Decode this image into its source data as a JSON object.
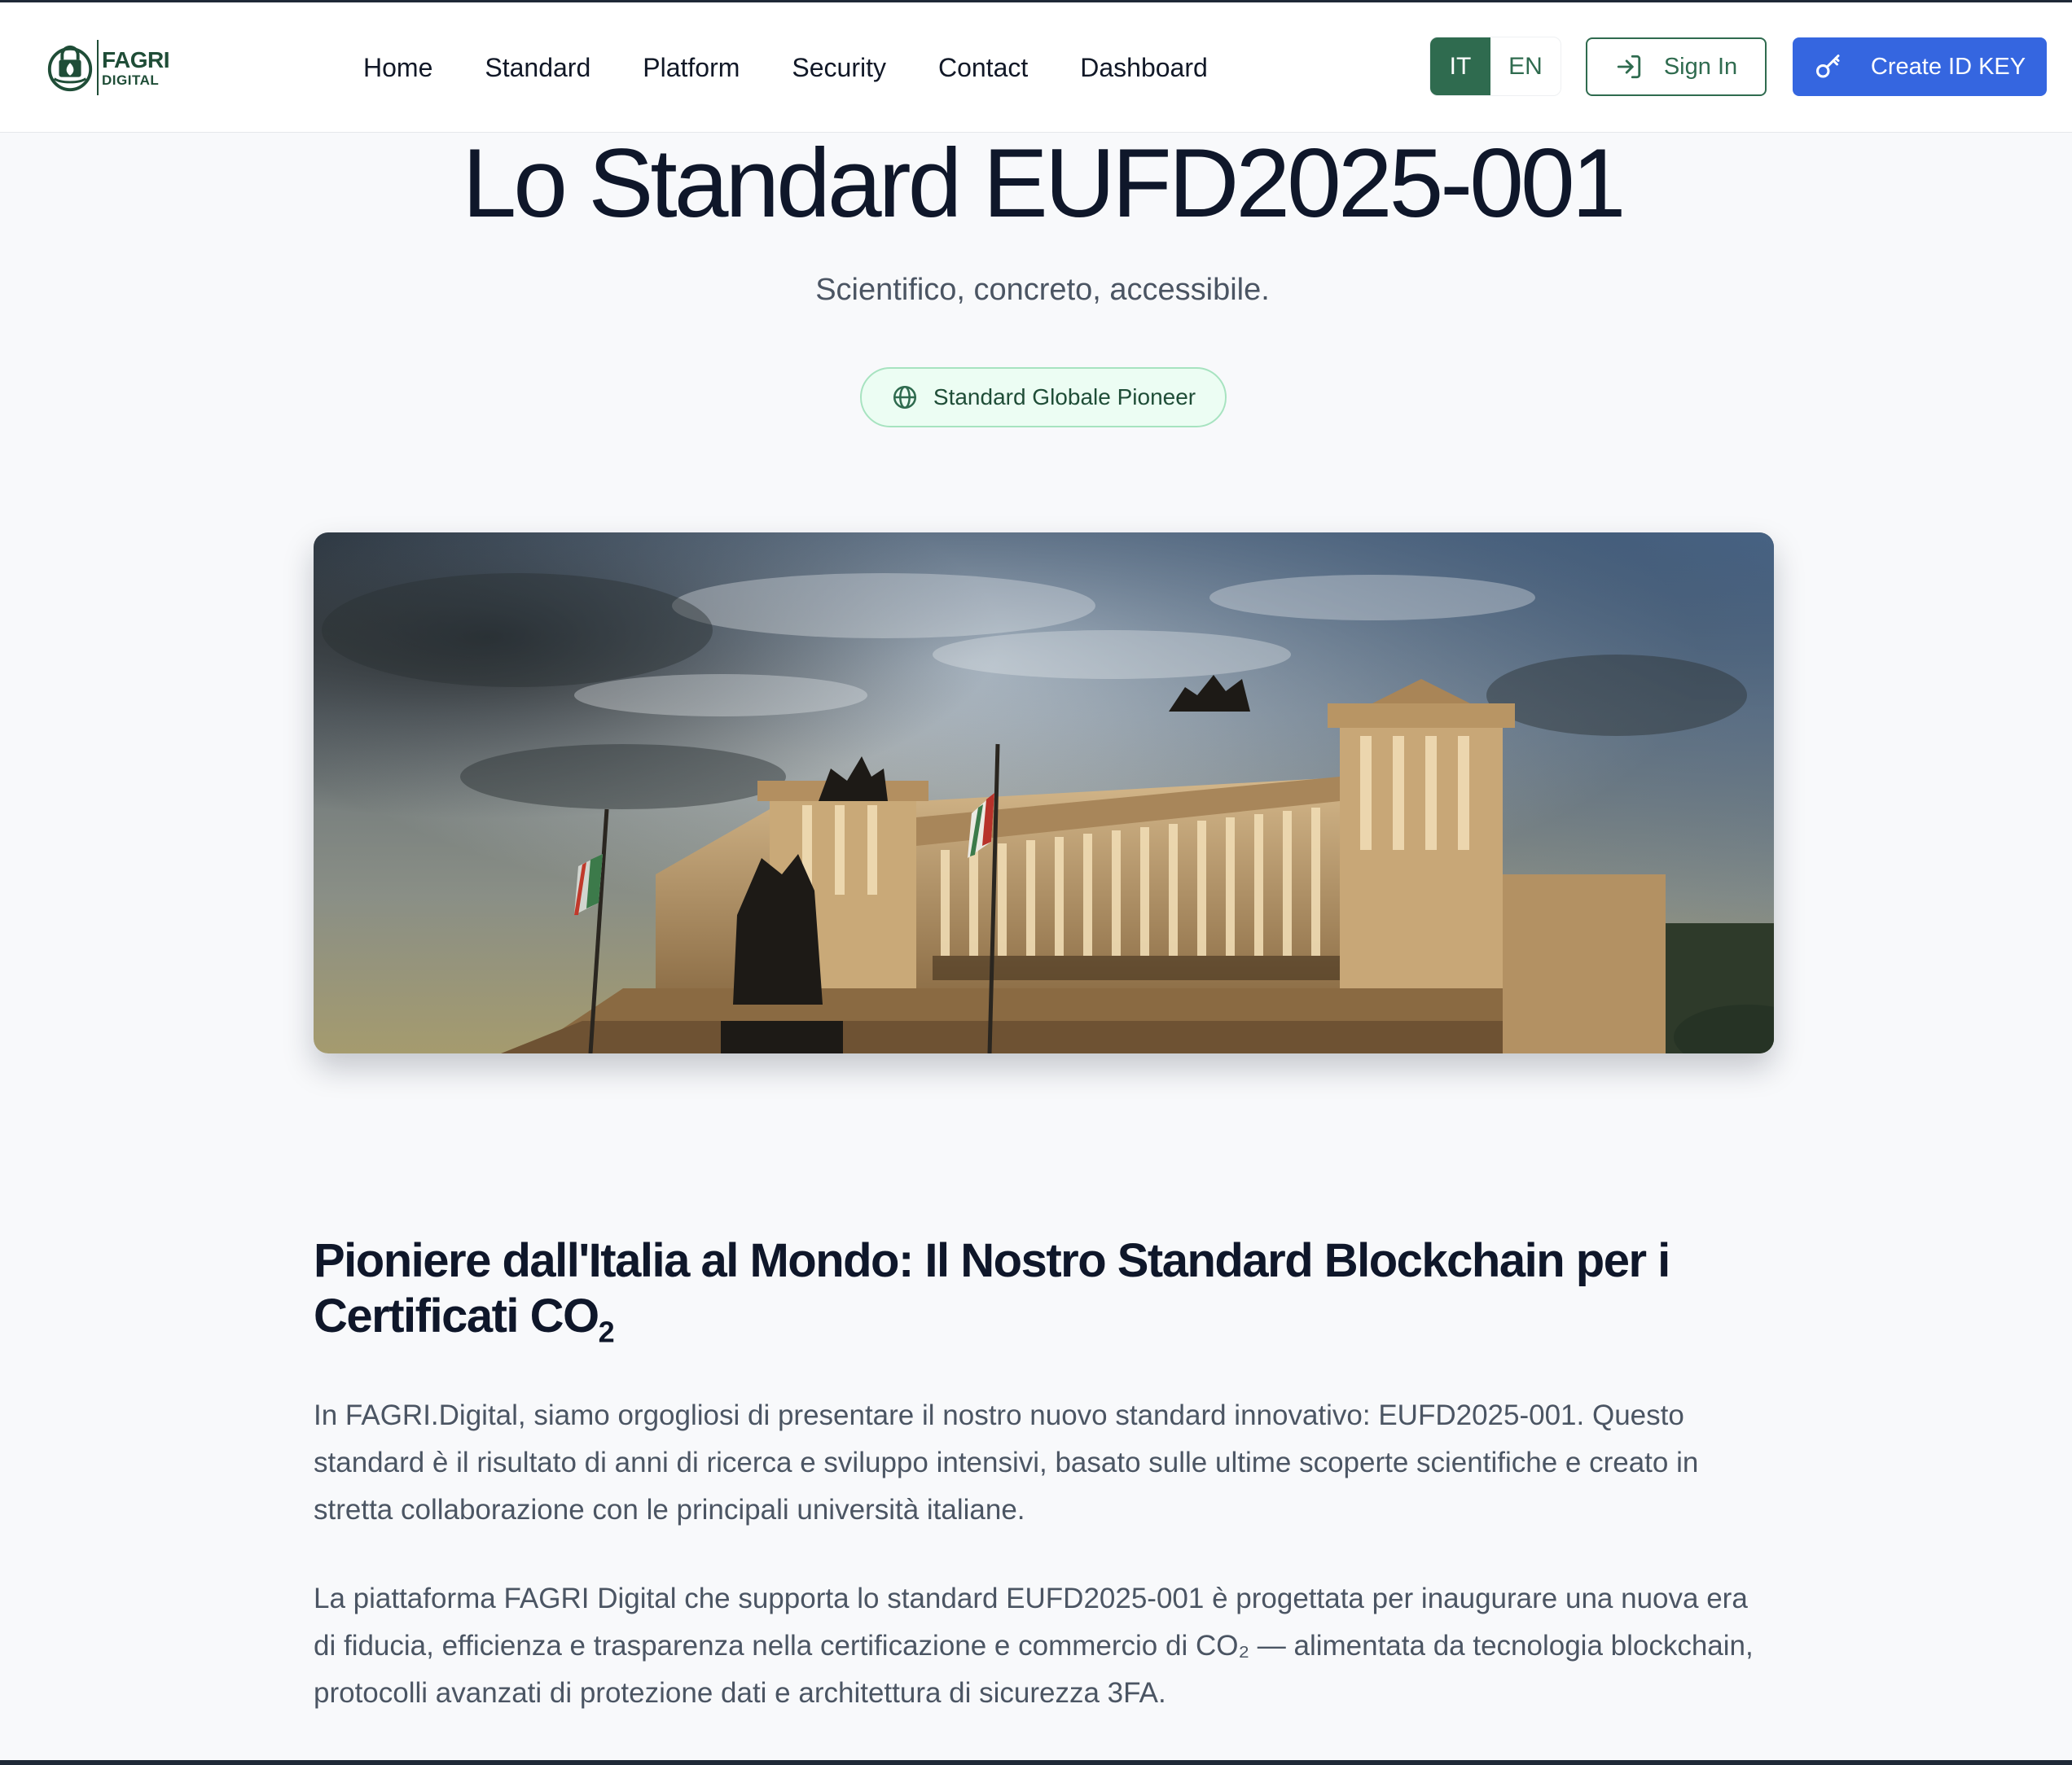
{
  "brand": {
    "line1": "FAGRI",
    "line2": "DIGITAL",
    "color": "#1f4d37"
  },
  "nav": {
    "items": [
      {
        "label": "Home"
      },
      {
        "label": "Standard"
      },
      {
        "label": "Platform"
      },
      {
        "label": "Security"
      },
      {
        "label": "Contact"
      },
      {
        "label": "Dashboard"
      }
    ]
  },
  "lang": {
    "it": "IT",
    "en": "EN",
    "selected": "IT"
  },
  "actions": {
    "sign_in": "Sign In",
    "create_id_key": "Create ID KEY"
  },
  "hero": {
    "title": "Lo Standard EUFD2025-001",
    "subtitle": "Scientifico, concreto, accessibile.",
    "badge": "Standard Globale Pioneer"
  },
  "article": {
    "heading_main": "Pioniere dall'Italia al Mondo: Il Nostro Standard Blockchain per i Certificati CO",
    "heading_sub": "2",
    "paragraph1": "In FAGRI.Digital, siamo orgogliosi di presentare il nostro nuovo standard innovativo: EUFD2025-001. Questo standard è il risultato di anni di ricerca e sviluppo intensivi, basato sulle ultime scoperte scientifiche e creato in stretta collaborazione con le principali università italiane.",
    "paragraph2": "La piattaforma FAGRI Digital che supporta lo standard EUFD2025-001 è progettata per inaugurare una nuova era di fiducia, efficienza e trasparenza nella certificazione e commercio di CO₂ — alimentata da tecnologia blockchain, protocolli avanzati di protezione dati e architettura di sicurezza 3FA."
  },
  "colors": {
    "primary_green": "#2f6b4f",
    "primary_blue": "#3566e0",
    "badge_bg": "#ecfdf3",
    "badge_border": "#a7e3c0"
  },
  "icons": {
    "sign_in": "sign-in-arrow-icon",
    "create": "key-icon",
    "badge": "globe-icon",
    "logo": "padlock-leaf-logo"
  }
}
